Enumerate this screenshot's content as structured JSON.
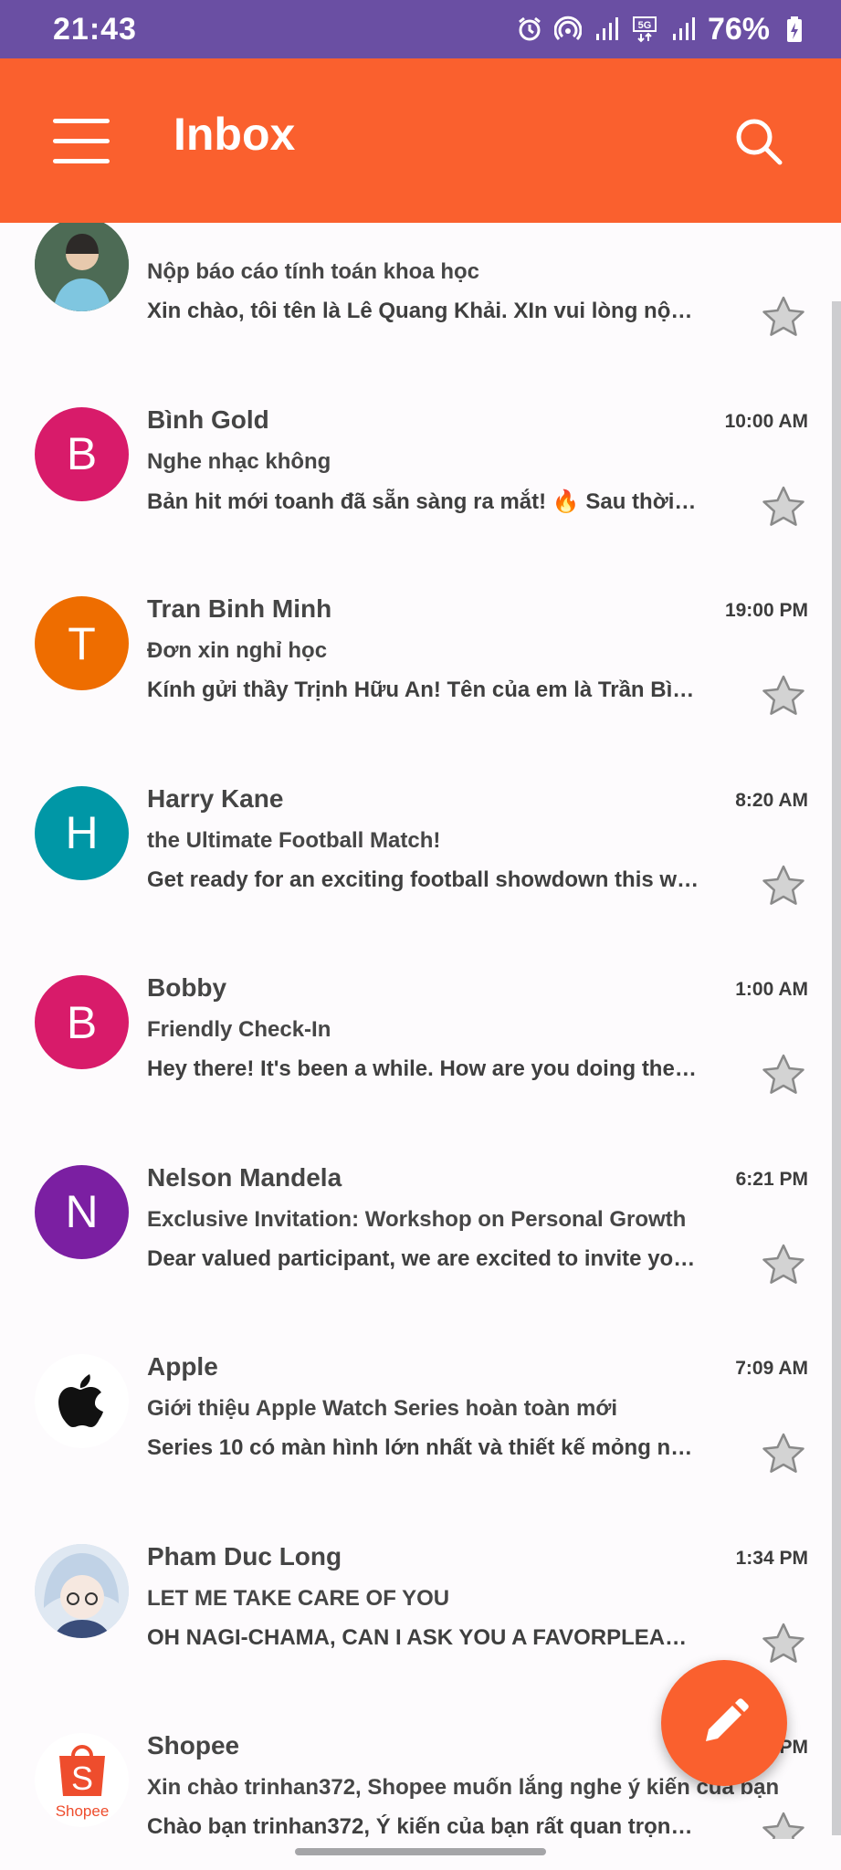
{
  "status_bar": {
    "time": "21:43",
    "battery": "76%",
    "network": "5G"
  },
  "app_bar": {
    "title": "Inbox"
  },
  "colors": {
    "status_bar": "#6a4fa3",
    "accent": "#fa602e",
    "star": "#9e9e9e"
  },
  "emails": [
    {
      "avatar_letter": "",
      "avatar_color": "#5a7a6a",
      "avatar_type": "photo-person",
      "sender": "",
      "time": "",
      "subject": "Nộp báo cáo tính toán khoa học",
      "preview": "Xin chào, tôi tên là Lê Quang Khải. XIn vui lòng nộp bài báo cáo"
    },
    {
      "avatar_letter": "B",
      "avatar_color": "#d81b6a",
      "avatar_type": "letter",
      "sender": "Bình Gold",
      "time": "10:00 AM",
      "subject": "Nghe nhạc không",
      "preview": "Bản hit mới toanh đã sẵn sàng ra mắt! 🔥 Sau thời gian dài chờ đợi"
    },
    {
      "avatar_letter": "T",
      "avatar_color": "#ee6d00",
      "avatar_type": "letter",
      "sender": "Tran Binh Minh",
      "time": "19:00 PM",
      "subject": "Đơn xin nghỉ học",
      "preview": "Kính gửi thầy Trịnh Hữu An! Tên của em là Trần Bình Minh"
    },
    {
      "avatar_letter": "H",
      "avatar_color": "#0097a6",
      "avatar_type": "letter",
      "sender": "Harry Kane",
      "time": "8:20 AM",
      "subject": "the Ultimate Football Match!",
      "preview": "Get ready for an exciting football showdown this weekend"
    },
    {
      "avatar_letter": "B",
      "avatar_color": "#d81b6a",
      "avatar_type": "letter",
      "sender": "Bobby",
      "time": "1:00 AM",
      "subject": "Friendly Check-In",
      "preview": "Hey there! It's been a while. How are you doing these days?"
    },
    {
      "avatar_letter": "N",
      "avatar_color": "#7b1fa2",
      "avatar_type": "letter",
      "sender": "Nelson Mandela",
      "time": "6:21 PM",
      "subject": "Exclusive Invitation: Workshop on Personal Growth",
      "preview": "Dear valued participant, we are excited to invite you to"
    },
    {
      "avatar_letter": "",
      "avatar_color": "#ffffff",
      "avatar_type": "apple-logo",
      "sender": "Apple",
      "time": "7:09 AM",
      "subject": "Giới thiệu Apple Watch Series hoàn toàn mới",
      "preview": "Series 10 có màn hình lớn nhất và thiết kế mỏng nhất từ trước"
    },
    {
      "avatar_letter": "",
      "avatar_color": "#c9d6e6",
      "avatar_type": "photo-anime",
      "sender": "Pham Duc Long",
      "time": "1:34 PM",
      "subject": "LET ME TAKE CARE OF YOU",
      "preview": "OH NAGI-CHAMA, CAN I ASK YOU A FAVORPLEASE ME"
    },
    {
      "avatar_letter": "",
      "avatar_color": "#ffffff",
      "avatar_type": "shopee-logo",
      "sender": "Shopee",
      "time": "PM",
      "subject": "Xin chào trinhan372, Shopee muốn lắng nghe ý kiến của bạn",
      "preview": "Chào bạn trinhan372, Ý kiến của bạn rất quan trọng. Mời bạn"
    }
  ],
  "shopee_logo_text": "Shopee",
  "icons": {
    "menu": "menu-icon",
    "search": "search-icon",
    "star": "star-outline-icon",
    "compose": "pencil-icon",
    "alarm": "alarm-icon",
    "hotspot": "hotspot-icon",
    "signal": "signal-icon",
    "battery": "battery-charging-icon"
  }
}
